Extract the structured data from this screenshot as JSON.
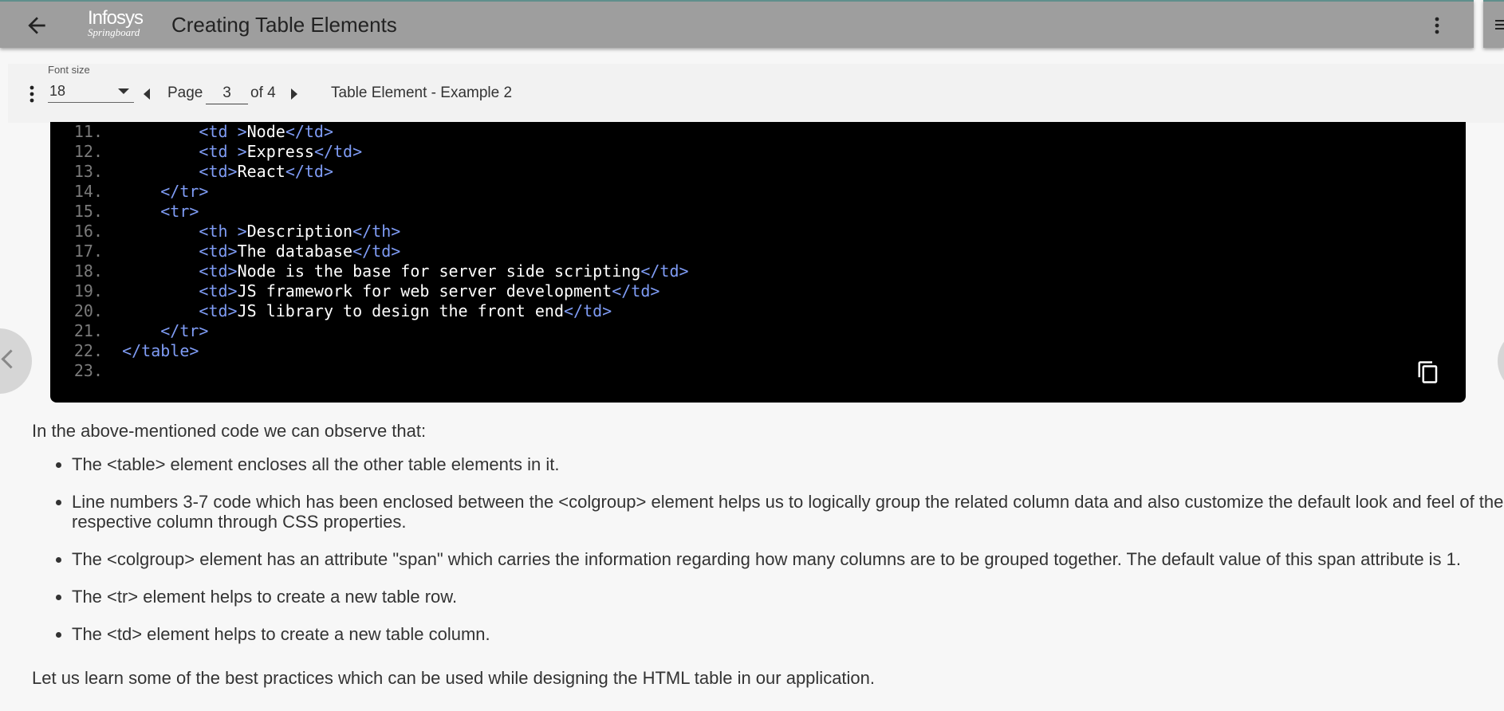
{
  "header": {
    "title": "Creating Table Elements",
    "logo_line1": "Infosys",
    "logo_line2": "Springboard"
  },
  "toolbar": {
    "font_size_label": "Font size",
    "font_size_value": "18",
    "page_label": "Page",
    "page_value": "3",
    "page_total": "of 4",
    "section_title": "Table Element - Example 2"
  },
  "code_lines": [
    {
      "n": "11.",
      "indent": "        ",
      "parts": [
        [
          "t",
          "<td >"
        ],
        [
          "x",
          "Node"
        ],
        [
          "t",
          "</td>"
        ]
      ]
    },
    {
      "n": "12.",
      "indent": "        ",
      "parts": [
        [
          "t",
          "<td >"
        ],
        [
          "x",
          "Express"
        ],
        [
          "t",
          "</td>"
        ]
      ]
    },
    {
      "n": "13.",
      "indent": "        ",
      "parts": [
        [
          "t",
          "<td>"
        ],
        [
          "x",
          "React"
        ],
        [
          "t",
          "</td>"
        ]
      ]
    },
    {
      "n": "14.",
      "indent": "    ",
      "parts": [
        [
          "t",
          "</tr>"
        ]
      ]
    },
    {
      "n": "15.",
      "indent": "    ",
      "parts": [
        [
          "t",
          "<tr>"
        ]
      ]
    },
    {
      "n": "16.",
      "indent": "        ",
      "parts": [
        [
          "t",
          "<th >"
        ],
        [
          "x",
          "Description"
        ],
        [
          "t",
          "</th>"
        ]
      ]
    },
    {
      "n": "17.",
      "indent": "        ",
      "parts": [
        [
          "t",
          "<td>"
        ],
        [
          "x",
          "The database"
        ],
        [
          "t",
          "</td>"
        ]
      ]
    },
    {
      "n": "18.",
      "indent": "        ",
      "parts": [
        [
          "t",
          "<td>"
        ],
        [
          "x",
          "Node is the base for server side scripting"
        ],
        [
          "t",
          "</td>"
        ]
      ]
    },
    {
      "n": "19.",
      "indent": "        ",
      "parts": [
        [
          "t",
          "<td>"
        ],
        [
          "x",
          "JS framework for web server development"
        ],
        [
          "t",
          "</td>"
        ]
      ]
    },
    {
      "n": "20.",
      "indent": "        ",
      "parts": [
        [
          "t",
          "<td>"
        ],
        [
          "x",
          "JS library to design the front end"
        ],
        [
          "t",
          "</td>"
        ]
      ]
    },
    {
      "n": "21.",
      "indent": "    ",
      "parts": [
        [
          "t",
          "</tr>"
        ]
      ]
    },
    {
      "n": "22.",
      "indent": "",
      "parts": [
        [
          "t",
          "</table>"
        ]
      ]
    },
    {
      "n": "23.",
      "indent": "",
      "parts": []
    }
  ],
  "content": {
    "intro": "In the above-mentioned code we can observe that:",
    "bullets": [
      "The <table> element encloses all the other table elements in it.",
      "Line numbers 3-7 code which has been enclosed between the <colgroup> element helps us to logically group the related column data and also customize the default look and feel of the respective column through CSS properties.",
      "The <colgroup> element has an attribute \"span\" which carries the information regarding how many columns are to be grouped together. The default value of this span attribute is 1.",
      "The <tr> element helps to create a new table row.",
      "The <td> element helps to create a new table column."
    ],
    "outro": "Let us learn some of the best practices which can be used while designing the HTML table in our application."
  },
  "colors": {
    "appbar": "#9e9e9e",
    "code_bg": "#000000",
    "code_tag": "#7f9cf5",
    "code_text": "#ffffff",
    "line_number": "#7b7b7b"
  }
}
